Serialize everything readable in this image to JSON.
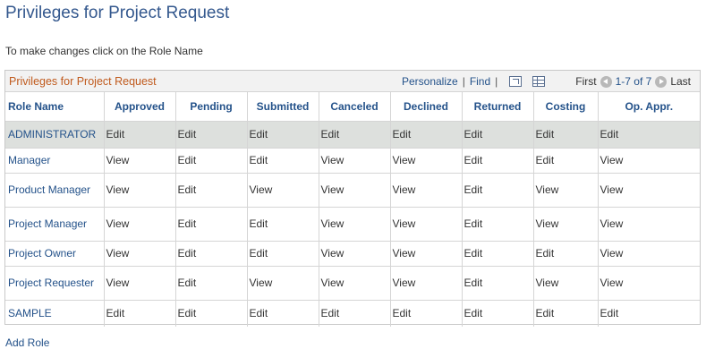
{
  "page": {
    "title": "Privileges for Project Request",
    "instructions": "To make changes click on the Role Name",
    "add_role_label": "Add Role"
  },
  "grid": {
    "title": "Privileges for Project Request",
    "nav": {
      "personalize": "Personalize",
      "find": "Find",
      "separator": "|",
      "first": "First",
      "range": "1-7 of 7",
      "last": "Last",
      "zoom_icon": "view-all-icon",
      "download_icon": "download-grid-icon"
    },
    "columns": [
      "Role Name",
      "Approved",
      "Pending",
      "Submitted",
      "Canceled",
      "Declined",
      "Returned",
      "Costing",
      "Op. Appr."
    ],
    "rows": [
      {
        "role": "ADMINISTRATOR",
        "cells": [
          "Edit",
          "Edit",
          "Edit",
          "Edit",
          "Edit",
          "Edit",
          "Edit",
          "Edit"
        ]
      },
      {
        "role": "Manager",
        "cells": [
          "View",
          "Edit",
          "Edit",
          "View",
          "View",
          "Edit",
          "Edit",
          "View"
        ]
      },
      {
        "role": "Product Manager",
        "cells": [
          "View",
          "Edit",
          "View",
          "View",
          "View",
          "Edit",
          "View",
          "View"
        ]
      },
      {
        "role": "Project Manager",
        "cells": [
          "View",
          "Edit",
          "Edit",
          "View",
          "View",
          "Edit",
          "View",
          "View"
        ]
      },
      {
        "role": "Project Owner",
        "cells": [
          "View",
          "Edit",
          "Edit",
          "View",
          "View",
          "Edit",
          "Edit",
          "View"
        ]
      },
      {
        "role": "Project Requester",
        "cells": [
          "View",
          "Edit",
          "View",
          "View",
          "View",
          "Edit",
          "View",
          "View"
        ]
      },
      {
        "role": "SAMPLE",
        "cells": [
          "Edit",
          "Edit",
          "Edit",
          "Edit",
          "Edit",
          "Edit",
          "Edit",
          "Edit"
        ]
      }
    ]
  },
  "colors": {
    "title": "#34588e",
    "link": "#24528a",
    "grid_title": "#c05a1d",
    "selected_row": "#dde0dd"
  }
}
